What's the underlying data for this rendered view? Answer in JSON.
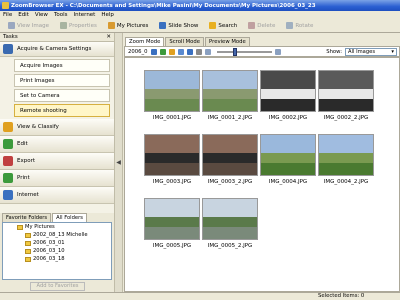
{
  "window": {
    "title": "ZoomBrowser EX - C:\\Documents and Settings\\Mike Pasini\\My Documents\\My Pictures\\2006_03_23"
  },
  "menu": [
    "File",
    "Edit",
    "View",
    "Tools",
    "Internet",
    "Help"
  ],
  "toolbar": [
    {
      "label": "View Image",
      "icon": "view-image-icon",
      "enabled": false,
      "color": "#9aa8c0"
    },
    {
      "label": "Properties",
      "icon": "properties-icon",
      "enabled": false,
      "color": "#a8b4a0"
    },
    {
      "label": "My Pictures",
      "icon": "my-pictures-icon",
      "enabled": true,
      "color": "#d89a30"
    },
    {
      "label": "Slide Show",
      "icon": "slide-show-icon",
      "enabled": true,
      "color": "#3a70c0"
    },
    {
      "label": "Search",
      "icon": "search-icon",
      "enabled": true,
      "color": "#e8b020"
    },
    {
      "label": "Delete",
      "icon": "delete-icon",
      "enabled": false,
      "color": "#c0a0a0"
    },
    {
      "label": "Rotate",
      "icon": "rotate-icon",
      "enabled": false,
      "color": "#a0b0c0"
    }
  ],
  "tasks": {
    "header": "Tasks",
    "acquire": {
      "label": "Acquire & Camera Settings",
      "icon": "camera-icon",
      "color": "#3a6ab0",
      "items": [
        "Acquire Images",
        "Print Images",
        "Set to Camera",
        "Remote shooting"
      ]
    },
    "sections": [
      {
        "label": "View & Classify",
        "icon": "view-classify-icon",
        "color": "#e0a020"
      },
      {
        "label": "Edit",
        "icon": "edit-icon",
        "color": "#3c9a3c"
      },
      {
        "label": "Export",
        "icon": "export-icon",
        "color": "#c04040"
      },
      {
        "label": "Print",
        "icon": "print-icon",
        "color": "#3c9a3c"
      },
      {
        "label": "Internet",
        "icon": "internet-icon",
        "color": "#3a70c0"
      }
    ]
  },
  "folders": {
    "tabs": [
      "Favorite Folders",
      "All Folders"
    ],
    "tree": [
      "My Pictures",
      "2002_08_13 Michelle",
      "2006_03_01",
      "2006_03_10",
      "2006_03_18"
    ],
    "add_button": "Add to Favorites"
  },
  "main": {
    "tabs": [
      "Zoom Mode",
      "Scroll Mode",
      "Preview Mode"
    ],
    "folder_label": "2006_0",
    "zoom_level": 0.3,
    "show_label": "Show:",
    "show_value": "All Images"
  },
  "thumbnails": [
    {
      "caption": "IMG_0001.JPG",
      "sky": "#9cb8d8",
      "ground": "#6a8a50",
      "subject": "#8a9a70"
    },
    {
      "caption": "IMG_0001_2.JPG",
      "sky": "#a8c0dc",
      "ground": "#6a8a50",
      "subject": "#8a9a70"
    },
    {
      "caption": "IMG_0002.JPG",
      "sky": "#4a4a4a",
      "ground": "#2a2a2a",
      "subject": "#e8e8e8"
    },
    {
      "caption": "IMG_0002_2.JPG",
      "sky": "#5a5a5a",
      "ground": "#2a2a2a",
      "subject": "#e8e8e8"
    },
    {
      "caption": "IMG_0003.JPG",
      "sky": "#8a6a5a",
      "ground": "#5a4a40",
      "subject": "#2a2a2a"
    },
    {
      "caption": "IMG_0003_2.JPG",
      "sky": "#8a6a5a",
      "ground": "#5a4a40",
      "subject": "#2a2a2a"
    },
    {
      "caption": "IMG_0004.JPG",
      "sky": "#9ab8dc",
      "ground": "#4a7a30",
      "subject": "#7a9a50"
    },
    {
      "caption": "IMG_0004_2.JPG",
      "sky": "#a0bce0",
      "ground": "#4a7a30",
      "subject": "#7a9a50"
    },
    {
      "caption": "IMG_0005.JPG",
      "sky": "#c8d4e0",
      "ground": "#7a8a7a",
      "subject": "#5a7a4a"
    },
    {
      "caption": "IMG_0005_2.JPG",
      "sky": "#c8d4e0",
      "ground": "#7a8a7a",
      "subject": "#5a7a4a"
    }
  ],
  "status": {
    "text": "Selected Items: 0"
  }
}
